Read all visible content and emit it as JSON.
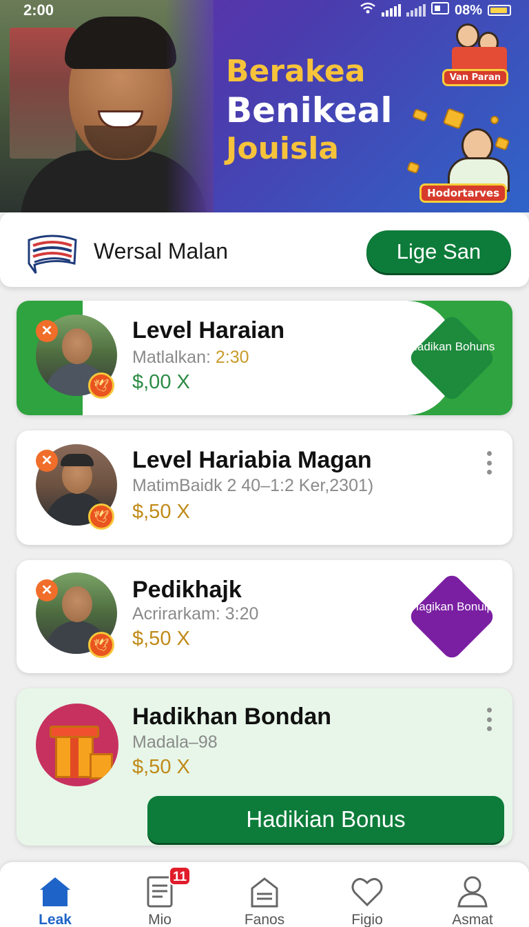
{
  "status_bar": {
    "time": "2:00",
    "battery": "08%"
  },
  "hero": {
    "title_lines": [
      "Berakea",
      "Benikeal",
      "Jouisla"
    ],
    "tag_top": "Van Paran",
    "tag_bottom": "Hodortarves"
  },
  "promo": {
    "name": "Wersal Malan",
    "button": "Lige San"
  },
  "cards": [
    {
      "title": "Level Haraian",
      "subtitle_prefix": "Matlalkan: ",
      "subtitle_value": "2:30",
      "price": "$,00 X",
      "badge": "Hadikan Bohuns"
    },
    {
      "title": "Level Hariabia Magan",
      "subtitle": "MatimBaidk 2 40–1:2  Ker,2301)",
      "price": "$,50 X"
    },
    {
      "title": "Pedikhajk",
      "subtitle": "Acrirarkam: 3:20",
      "price": "$,50 X",
      "badge": "Hagikan Bonuip"
    },
    {
      "title": "Hadikhan Bondan",
      "subtitle": "Madala–98",
      "price": "$,50 X",
      "button": "Hadikian Bonus"
    }
  ],
  "bottom_nav": [
    {
      "label": "Leak",
      "icon": "home-icon",
      "active": true
    },
    {
      "label": "Mio",
      "icon": "document-icon",
      "badge": "11"
    },
    {
      "label": "Fanos",
      "icon": "inbox-icon"
    },
    {
      "label": "Figio",
      "icon": "heart-icon"
    },
    {
      "label": "Asmat",
      "icon": "person-icon"
    }
  ],
  "colors": {
    "accent_green": "#0d7c3a",
    "card_green": "#2fa33f",
    "purple": "#7a1fa2",
    "nav_active": "#1e64c8",
    "gold": "#c08a18"
  }
}
